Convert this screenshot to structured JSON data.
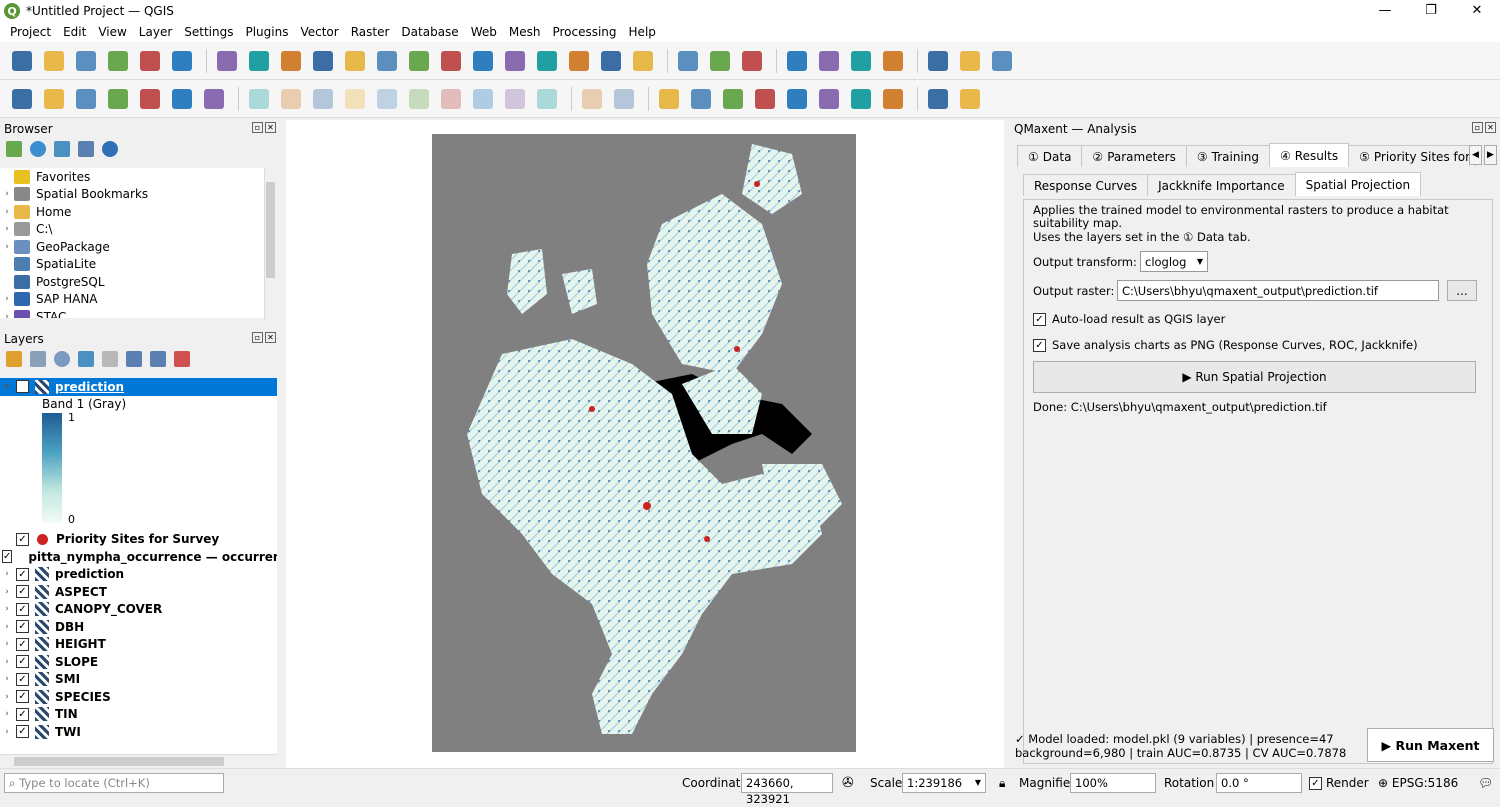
{
  "window": {
    "title": "*Untitled Project — QGIS",
    "minimize": "—",
    "maximize": "❐",
    "close": "✕"
  },
  "menu": [
    "Project",
    "Edit",
    "View",
    "Layer",
    "Settings",
    "Plugins",
    "Vector",
    "Raster",
    "Database",
    "Web",
    "Mesh",
    "Processing",
    "Help"
  ],
  "toolbar1_icons": [
    "new-project-icon",
    "open-project-icon",
    "save-project-icon",
    "new-print-layout-icon",
    "layout-manager-icon",
    "style-manager-icon",
    "pan-icon",
    "pan-to-selection-icon",
    "zoom-in-icon",
    "zoom-out-icon",
    "zoom-full-icon",
    "zoom-to-selection-icon",
    "zoom-to-layer-icon",
    "zoom-native-icon",
    "zoom-last-icon",
    "zoom-next-icon",
    "new-bookmark-icon",
    "show-bookmarks-icon",
    "temporal-controller-icon",
    "refresh-icon",
    "select-features-icon",
    "deselect-icon",
    "open-attribute-table-icon",
    "identify-icon",
    "field-calculator-icon",
    "processing-toolbox-icon",
    "statistics-icon",
    "measure-icon",
    "annotation-icon",
    "label-icon"
  ],
  "toolbar2_icons": [
    "data-source-manager-icon",
    "new-geopackage-icon",
    "new-shapefile-icon",
    "new-spatialite-icon",
    "new-temp-layer-icon",
    "new-virtual-layer-icon",
    "add-vector-icon",
    "edit-toggle-icon",
    "current-edits-icon",
    "save-edits-icon",
    "digitize-icon",
    "vertex-tool-icon",
    "modify-attributes-icon",
    "delete-selected-icon",
    "cut-features-icon",
    "copy-features-icon",
    "paste-features-icon",
    "undo-icon",
    "redo-icon",
    "label-pin-icon",
    "label-show-icon",
    "label-toolbar-icon",
    "label-abc-icon",
    "label-move-icon",
    "label-rotate-icon",
    "label-change-icon",
    "diagram-icon",
    "python-console-icon",
    "help-icon"
  ],
  "browser": {
    "title": "Browser",
    "items": [
      {
        "label": "Favorites",
        "icon": "star-icon",
        "color": "#e8c020"
      },
      {
        "label": "Spatial Bookmarks",
        "icon": "bookmark-icon",
        "color": "#888888"
      },
      {
        "label": "Home",
        "icon": "folder-icon",
        "color": "#e8b84a"
      },
      {
        "label": "C:\\",
        "icon": "drive-icon",
        "color": "#9a9a9a"
      },
      {
        "label": "GeoPackage",
        "icon": "geopackage-icon",
        "color": "#6a8fc0"
      },
      {
        "label": "SpatiaLite",
        "icon": "spatialite-icon",
        "color": "#4a7fb0"
      },
      {
        "label": "PostgreSQL",
        "icon": "postgresql-icon",
        "color": "#3a6ea5"
      },
      {
        "label": "SAP HANA",
        "icon": "saphana-icon",
        "color": "#2e66b0"
      },
      {
        "label": "STAC",
        "icon": "stac-icon",
        "color": "#6d4fb0"
      }
    ]
  },
  "layers": {
    "title": "Layers",
    "band_label": "Band 1 (Gray)",
    "ramp_max": "1",
    "ramp_min": "0",
    "items": [
      {
        "label": "prediction",
        "type": "raster",
        "selected": true,
        "expanded": true
      },
      {
        "label": "Priority Sites for Survey",
        "type": "point",
        "color": "#cc2222"
      },
      {
        "label": "pitta_nympha_occurrence — occurrence",
        "type": "point",
        "color": "#2a5a8a"
      },
      {
        "label": "prediction",
        "type": "raster"
      },
      {
        "label": "ASPECT",
        "type": "raster"
      },
      {
        "label": "CANOPY_COVER",
        "type": "raster"
      },
      {
        "label": "DBH",
        "type": "raster"
      },
      {
        "label": "HEIGHT",
        "type": "raster"
      },
      {
        "label": "SLOPE",
        "type": "raster"
      },
      {
        "label": "SMI",
        "type": "raster"
      },
      {
        "label": "SPECIES",
        "type": "raster"
      },
      {
        "label": "TIN",
        "type": "raster"
      },
      {
        "label": "TWI",
        "type": "raster"
      }
    ]
  },
  "qmaxent": {
    "title": "QMaxent — Analysis",
    "tabs": [
      "Data",
      "Parameters",
      "Training",
      "Results",
      "Priority Sites for S"
    ],
    "tab_icons": [
      "①",
      "②",
      "③",
      "④",
      "⑤"
    ],
    "active_tab": "Results",
    "subtabs": [
      "Response Curves",
      "Jackknife Importance",
      "Spatial Projection"
    ],
    "active_subtab": "Spatial Projection",
    "description_line1": "Applies the trained model to environmental rasters to produce a habitat",
    "description_line2": "suitability map.",
    "description_line3": "Uses the layers set in the ① Data tab.",
    "output_transform_label": "Output transform:",
    "output_transform_value": "cloglog",
    "output_raster_label": "Output raster:",
    "output_raster_value": "C:\\Users\\bhyu\\qmaxent_output\\prediction.tif",
    "browse_label": "...",
    "autoload_label": "Auto-load result as QGIS layer",
    "save_charts_label": "Save analysis charts as PNG (Response Curves, ROC, Jackknife)",
    "run_projection_label": "▶  Run Spatial Projection",
    "done_text": "Done: C:\\Users\\bhyu\\qmaxent_output\\prediction.tif",
    "status_line1": "✓ Model loaded: model.pkl  (9 variables)  |  presence=47",
    "status_line2": "background=6,980  |  train AUC=0.8735  |  CV AUC=0.7878",
    "run_maxent_label": "▶  Run Maxent"
  },
  "statusbar": {
    "locate_placeholder": "Type to locate (Ctrl+K)",
    "coordinate_label": "Coordinate",
    "coordinate_value": "243660, 323921",
    "scale_label": "Scale",
    "scale_value": "1:239186",
    "magnifier_label": "Magnifier",
    "magnifier_value": "100%",
    "rotation_label": "Rotation",
    "rotation_value": "0.0 °",
    "render_label": "Render",
    "crs_label": "EPSG:5186"
  }
}
